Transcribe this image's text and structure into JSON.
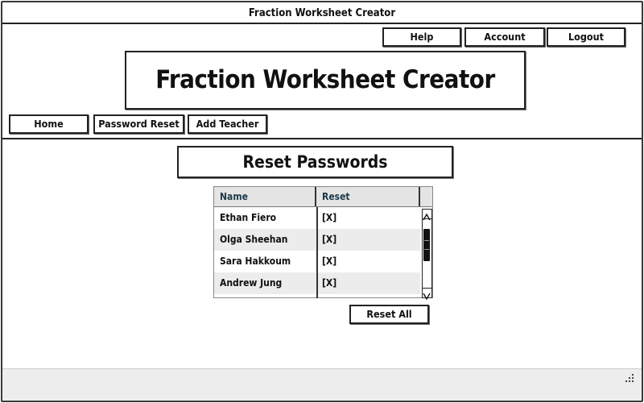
{
  "window": {
    "title": "Fraction Worksheet Creator"
  },
  "top_nav": {
    "help_label": "Help",
    "account_label": "Account",
    "logout_label": "Logout"
  },
  "header": {
    "app_title": "Fraction Worksheet Creator"
  },
  "main_nav": {
    "home_label": "Home",
    "password_reset_label": "Password Reset",
    "add_teacher_label": "Add Teacher"
  },
  "section": {
    "title": "Reset Passwords"
  },
  "table": {
    "columns": [
      "Name",
      "Reset"
    ],
    "rows": [
      {
        "name": "Ethan Fiero",
        "reset": "[X]"
      },
      {
        "name": "Olga Sheehan",
        "reset": "[X]"
      },
      {
        "name": "Sara Hakkoum",
        "reset": "[X]"
      },
      {
        "name": "Andrew Jung",
        "reset": "[X]"
      }
    ]
  },
  "actions": {
    "reset_all_label": "Reset All"
  },
  "icons": {
    "resize_grip": "resize-grip-icon",
    "scroll_up": "chevron-up-icon",
    "scroll_down": "chevron-down-icon"
  }
}
